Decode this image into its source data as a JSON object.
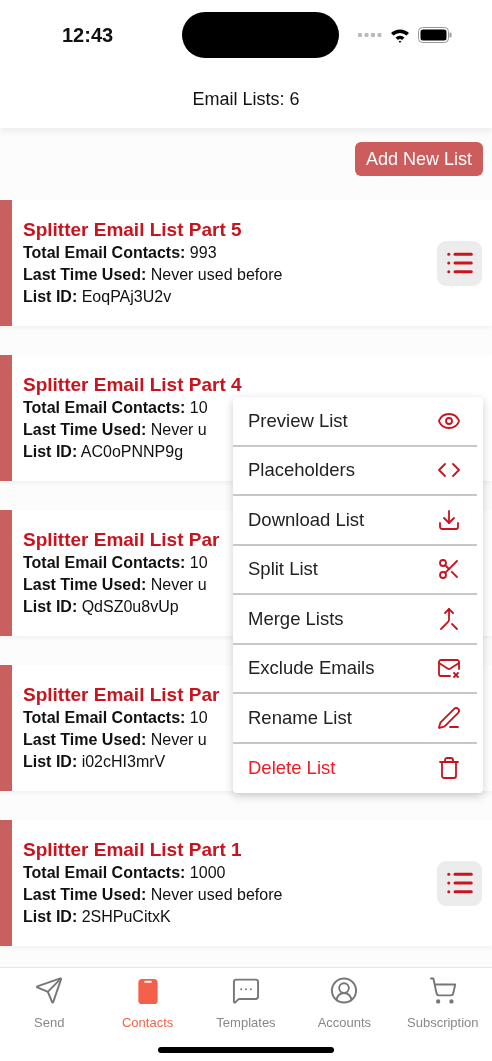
{
  "status_bar": {
    "time": "12:43"
  },
  "header": {
    "title": "Email Lists: 6"
  },
  "add_button": "Add New List",
  "lists": [
    {
      "title": "Splitter Email List Part 5",
      "contacts": "**Total Email Contacts:** 993",
      "last_used": "**Last Time Used:** Never used before",
      "list_id": "**List ID:** EoqPAj3U2v",
      "menu_button": true
    },
    {
      "title": "Splitter Email List Part 4",
      "contacts": "**Total Email Contacts:** 10",
      "last_used": "**Last Time Used:** Never u",
      "list_id": "**List ID:** AC0oPNNP9g"
    },
    {
      "title": "Splitter Email List Par",
      "contacts": "**Total Email Contacts:** 10",
      "last_used": "**Last Time Used:** Never u",
      "list_id": "**List ID:** QdSZ0u8vUp"
    },
    {
      "title": "Splitter Email List Par",
      "contacts": "**Total Email Contacts:** 10",
      "last_used": "**Last Time Used:** Never u",
      "list_id": "**List ID:** i02cHI3mrV"
    },
    {
      "title": "Splitter Email List Part 1",
      "contacts": "**Total Email Contacts:** 1000",
      "last_used": "**Last Time Used:** Never used before",
      "list_id": "**List ID:** 2SHPuCitxK",
      "menu_button": true
    }
  ],
  "context_menu": [
    {
      "label": "Preview List",
      "kind": "normal"
    },
    {
      "label": "Placeholders",
      "kind": "normal"
    },
    {
      "label": "Download List",
      "kind": "normal"
    },
    {
      "label": "Split List",
      "kind": "normal"
    },
    {
      "label": "Merge Lists",
      "kind": "normal"
    },
    {
      "label": "Exclude Emails",
      "kind": "normal"
    },
    {
      "label": "Rename List",
      "kind": "normal"
    },
    {
      "label": "Delete List",
      "kind": "destructive"
    }
  ],
  "tab_bar": [
    {
      "label": "Send",
      "selected": false
    },
    {
      "label": "Contacts",
      "selected": true
    },
    {
      "label": "Templates",
      "selected": false
    },
    {
      "label": "Accounts",
      "selected": false
    },
    {
      "label": "Subscription",
      "selected": false
    }
  ]
}
